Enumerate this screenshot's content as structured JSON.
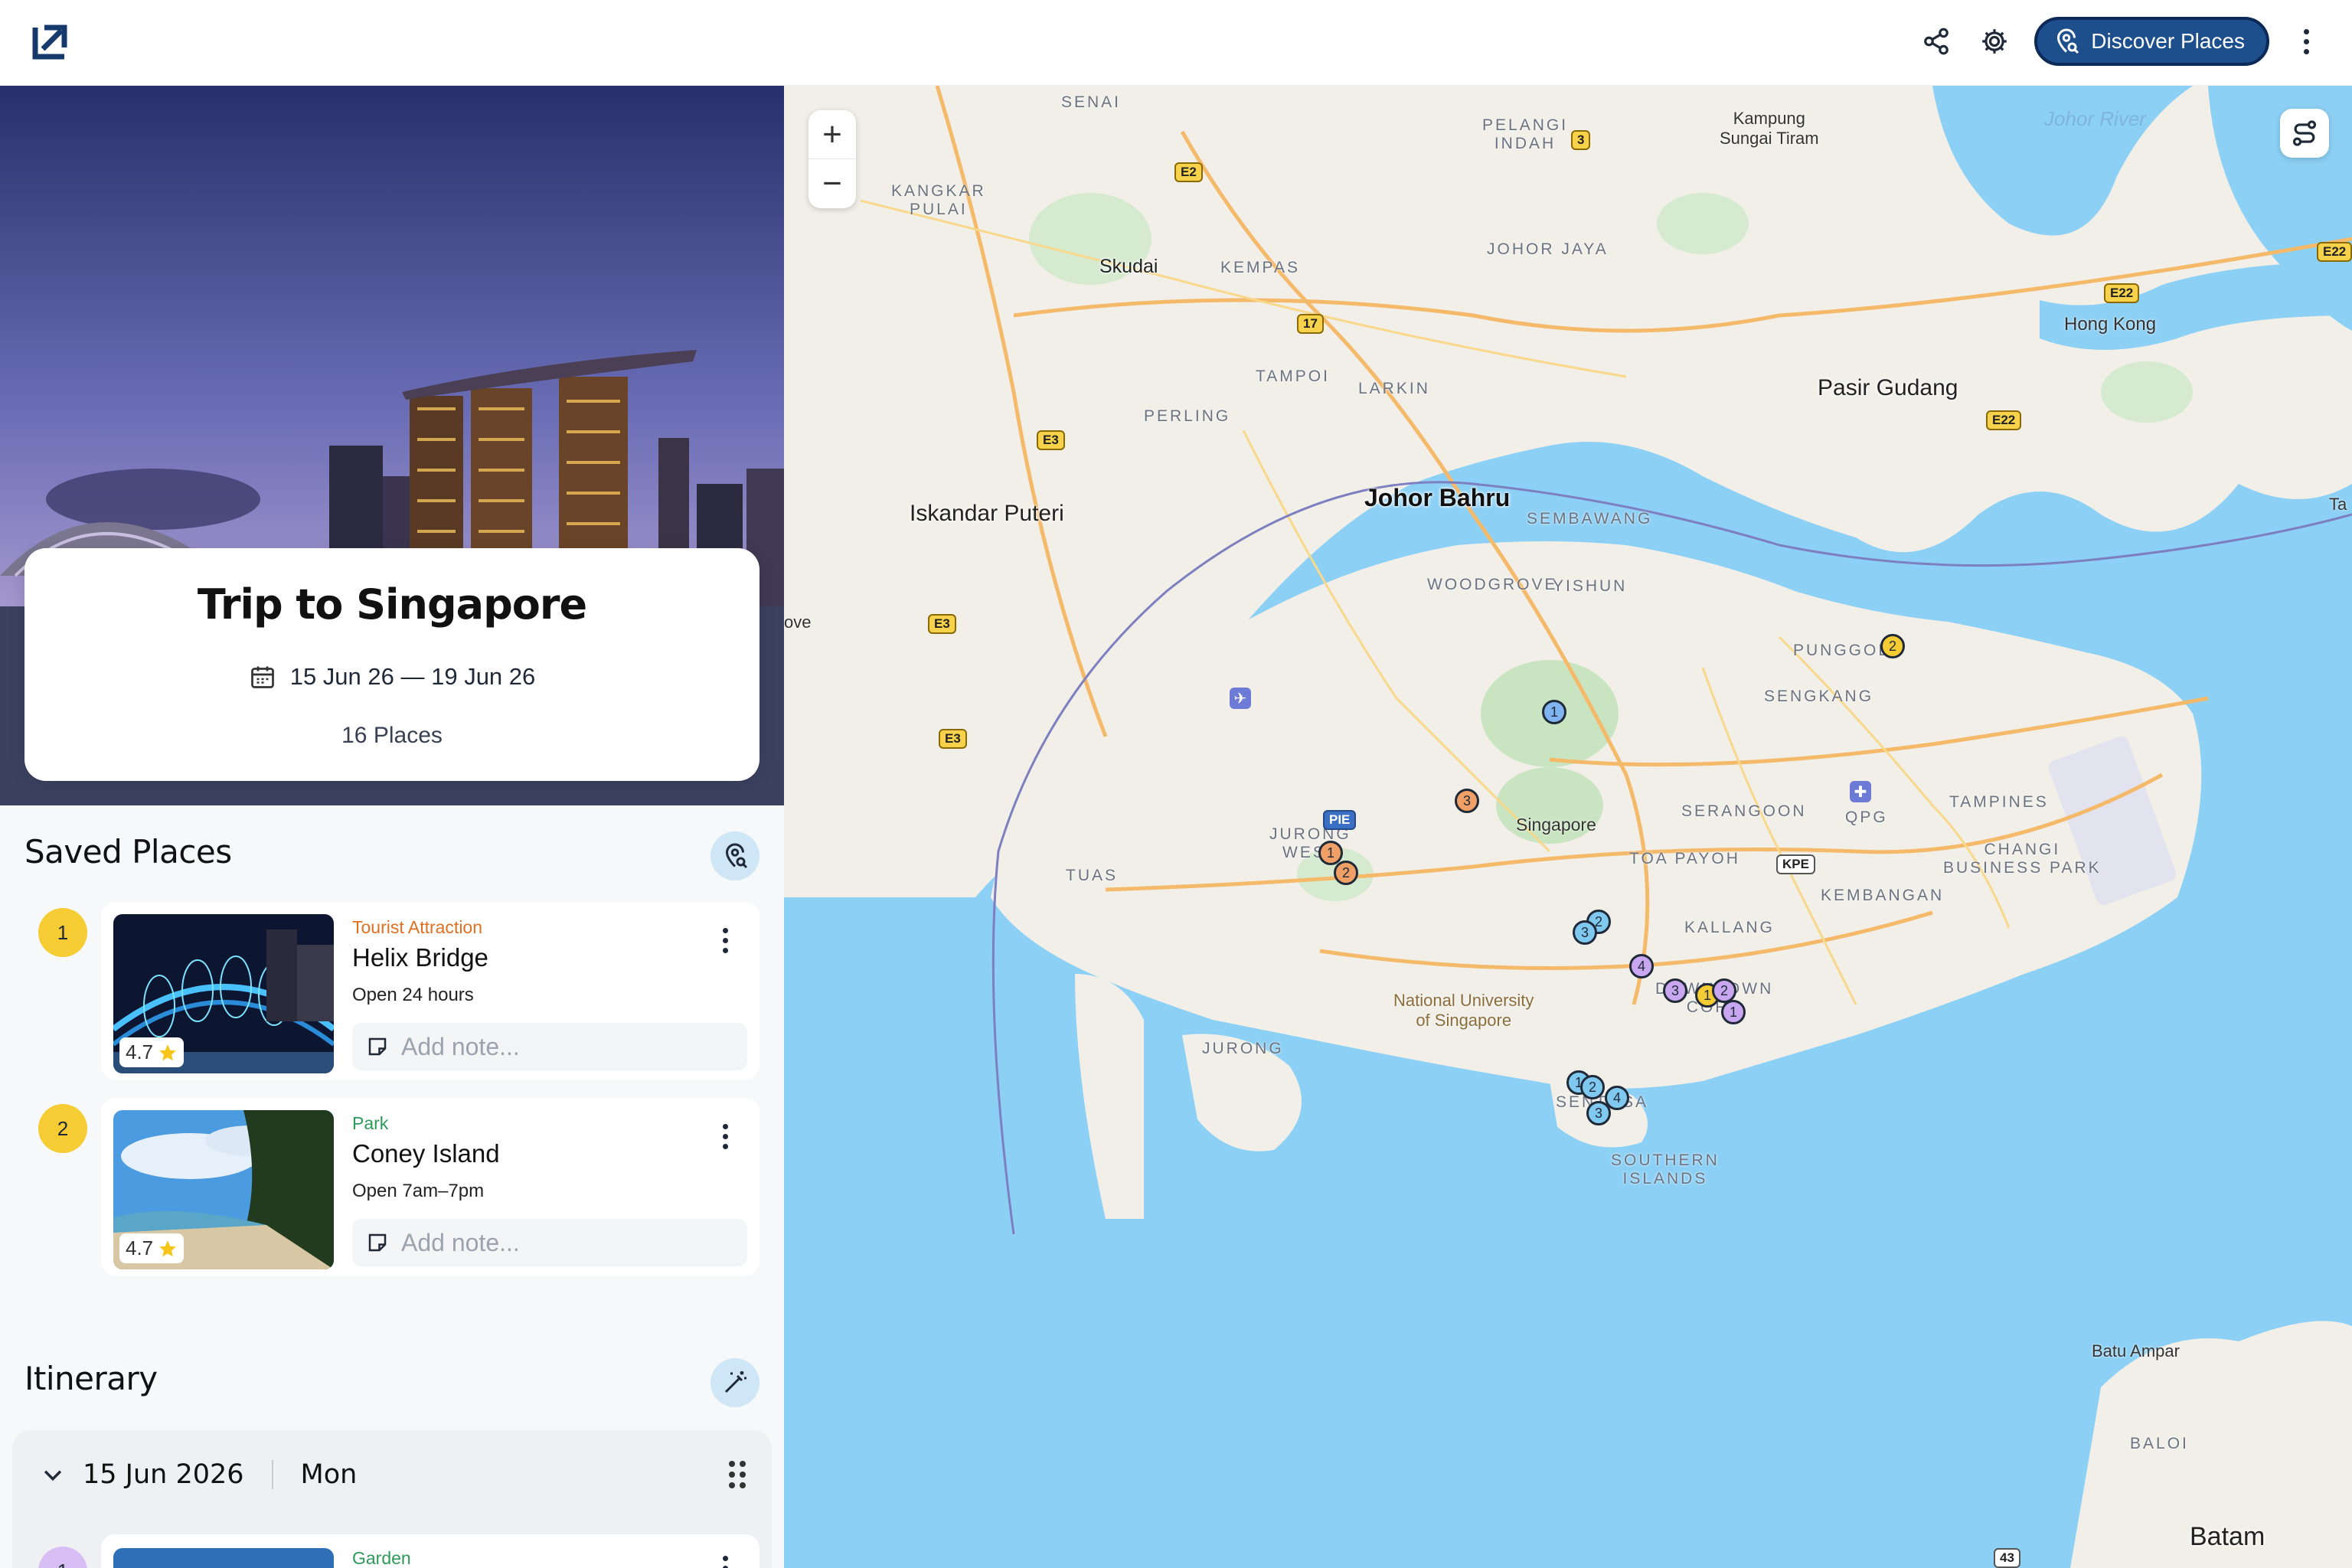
{
  "topbar": {
    "discover_label": "Discover Places"
  },
  "trip": {
    "title": "Trip to Singapore",
    "dates": "15 Jun 26 — 19 Jun 26",
    "places_count": "16 Places"
  },
  "saved": {
    "title": "Saved Places",
    "places": [
      {
        "num": "1",
        "category": "Tourist Attraction",
        "category_color": "#e07020",
        "name": "Helix Bridge",
        "hours": "Open 24 hours",
        "rating": "4.7",
        "note_placeholder": "Add note..."
      },
      {
        "num": "2",
        "category": "Park",
        "category_color": "#2e9a5a",
        "name": "Coney Island",
        "hours": "Open 7am–7pm",
        "rating": "4.7",
        "note_placeholder": "Add note..."
      }
    ]
  },
  "itinerary": {
    "title": "Itinerary",
    "day": {
      "date": "15 Jun 2026",
      "weekday": "Mon",
      "first_num": "1",
      "first_category": "Garden"
    }
  },
  "map": {
    "labels": {
      "senai": "SENAI",
      "kangkar_pulai": "KANGKAR\nPULAI",
      "skudai": "Skudai",
      "kempas": "KEMPAS",
      "tampoi": "TAMPOI",
      "larkin": "LARKIN",
      "perling": "PERLING",
      "pelangi_indah": "PELANGI\nINDAH",
      "kampung": "Kampung\nSungai Tiram",
      "johor_river": "Johor River",
      "johor_jaya": "JOHOR JAYA",
      "hong_kong": "Hong Kong",
      "pasir_gudang": "Pasir Gudang",
      "iskandar": "Iskandar Puteri",
      "johor_bahru": "Johor Bahru",
      "sembawang": "SEMBAWANG",
      "woodgrove": "WOODGROVE",
      "yishun": "YISHUN",
      "punggol": "PUNGGOL",
      "sengkang": "SENGKANG",
      "singapore": "Singapore",
      "serangoon": "SERANGOON",
      "qpg": "QPG",
      "tampines": "TAMPINES",
      "changi": "CHANGI\nBUSINESS PARK",
      "jurong_west": "JURONG\nWEST",
      "tuas": "TUAS",
      "toa_payoh": "TOA PAYOH",
      "kallang": "KALLANG",
      "kembangan": "KEMBANGAN",
      "nus": "National University\nof Singapore",
      "downtown": "DOWNTOWN\nCORE",
      "jurong": "JURONG",
      "sentosa": "SENTOSA",
      "southern": "SOUTHERN\nISLANDS",
      "batu_ampar": "Batu Ampar",
      "baloi": "BALOI",
      "batam": "Batam",
      "ta": "Ta",
      "ove": "ove"
    },
    "shields": {
      "e2": "E2",
      "r3": "3",
      "r17": "17",
      "e3a": "E3",
      "e3b": "E3",
      "e3c": "E3",
      "e22a": "E22",
      "e22b": "E22",
      "e22c": "E22",
      "pie": "PIE",
      "kpe": "KPE",
      "r43": "43"
    },
    "pins": [
      {
        "label": "1",
        "color": "#7fb4f0"
      },
      {
        "label": "2",
        "color": "#f5cc34"
      },
      {
        "label": "3",
        "color": "#f0a066"
      },
      {
        "label": "1",
        "color": "#f0a066"
      },
      {
        "label": "2",
        "color": "#f0a066"
      },
      {
        "label": "2",
        "color": "#7fc8f0"
      },
      {
        "label": "3",
        "color": "#7fc8f0"
      },
      {
        "label": "4",
        "color": "#c9a6f0"
      },
      {
        "label": "3",
        "color": "#c9a6f0"
      },
      {
        "label": "1",
        "color": "#f5cc34"
      },
      {
        "label": "2",
        "color": "#c9a6f0"
      },
      {
        "label": "1",
        "color": "#c9a6f0"
      },
      {
        "label": "1",
        "color": "#7fc8f0"
      },
      {
        "label": "2",
        "color": "#7fc8f0"
      },
      {
        "label": "4",
        "color": "#7fc8f0"
      },
      {
        "label": "3",
        "color": "#7fc8f0"
      }
    ]
  }
}
